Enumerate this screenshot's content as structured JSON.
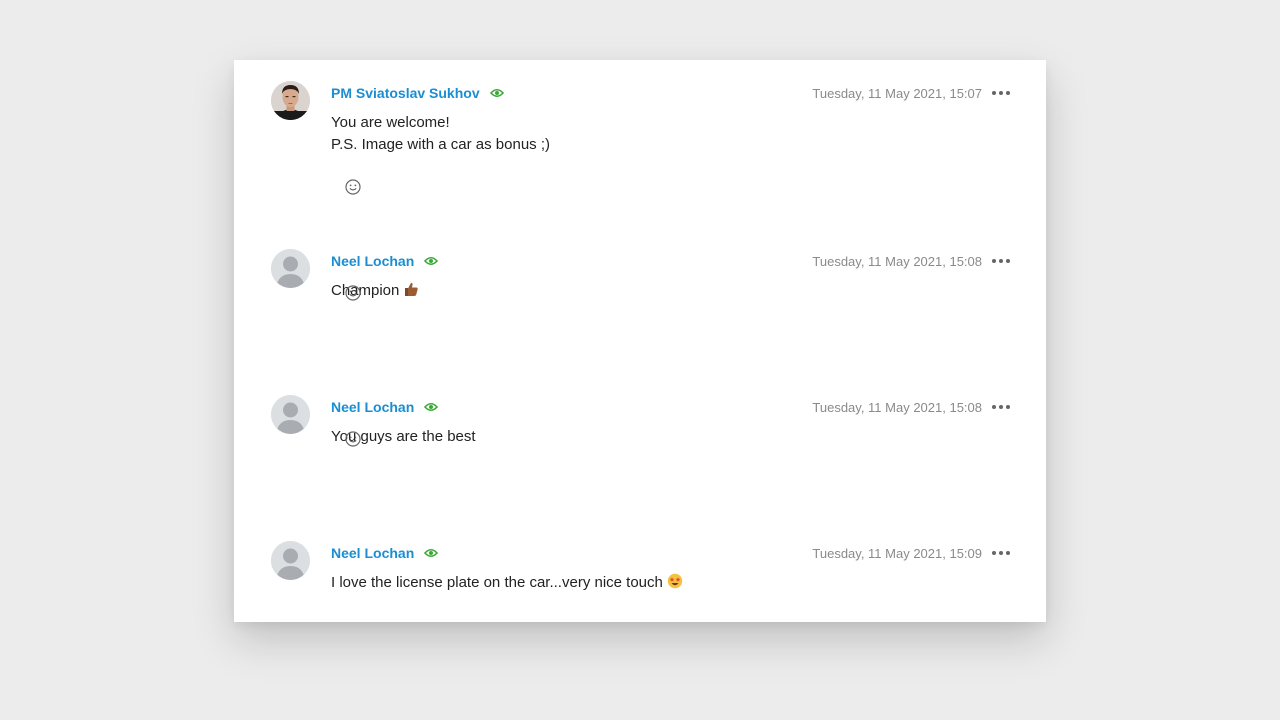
{
  "comments": [
    {
      "author": "PM Sviatoslav Sukhov",
      "avatar": "photo",
      "timestamp": "Tuesday, 11 May 2021, 15:07",
      "lines": [
        "You are welcome!",
        "P.S. Image with a car as bonus ;)"
      ],
      "has_reaction_button": true
    },
    {
      "author": "Neel Lochan",
      "avatar": "placeholder",
      "timestamp": "Tuesday, 11 May 2021, 15:08",
      "lines": [
        "Champion"
      ],
      "trailing_emoji": "thumbs-up-icon",
      "has_reaction_button": true
    },
    {
      "author": "Neel Lochan",
      "avatar": "placeholder",
      "timestamp": "Tuesday, 11 May 2021, 15:08",
      "lines": [
        "You guys are the best"
      ],
      "has_reaction_button": true
    },
    {
      "author": "Neel Lochan",
      "avatar": "placeholder",
      "timestamp": "Tuesday, 11 May 2021, 15:09",
      "lines": [
        "I love the license plate on the car...very nice touch"
      ],
      "trailing_emoji": "star-struck-icon",
      "has_reaction_button": false
    }
  ],
  "colors": {
    "author": "#1a8ed1",
    "seen_icon": "#3aaa35",
    "timestamp": "#8a8a8a",
    "background": "#ececec",
    "card": "#ffffff"
  }
}
